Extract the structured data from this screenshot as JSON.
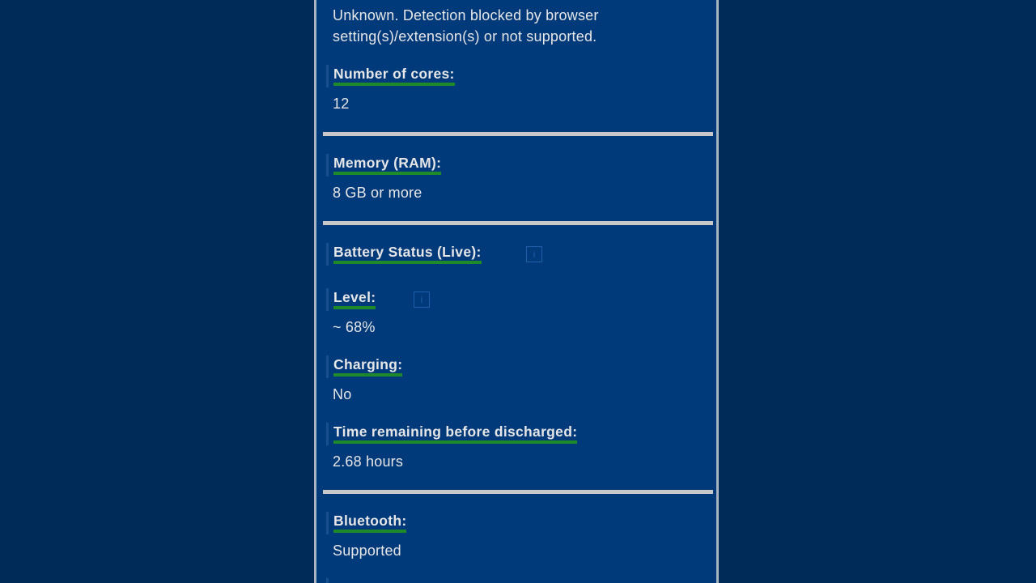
{
  "gpu": {
    "value_line1": "Unknown. Detection blocked by browser",
    "value_line2": "setting(s)/extension(s) or not supported."
  },
  "cores": {
    "label": "Number of cores:",
    "value": "12"
  },
  "memory": {
    "label": "Memory (RAM):",
    "value": "8 GB or more"
  },
  "battery": {
    "label": "Battery Status (Live):",
    "info_icon": "info-icon",
    "info_text": "i",
    "level_label": "Level:",
    "level_info_text": "i",
    "level_value": "~ 68%",
    "level_percent": 68,
    "charging_label": "Charging:",
    "charging_value": "No",
    "time_label": "Time remaining before discharged:",
    "time_value": "2.68 hours"
  },
  "bluetooth": {
    "label": "Bluetooth:",
    "value": "Supported"
  },
  "colors": {
    "page_background": "#002a57",
    "panel_background": "#003a7a",
    "text": "#e6e6e6",
    "label_underline": "#1e8a2a",
    "separator": "#c8c8c8"
  }
}
